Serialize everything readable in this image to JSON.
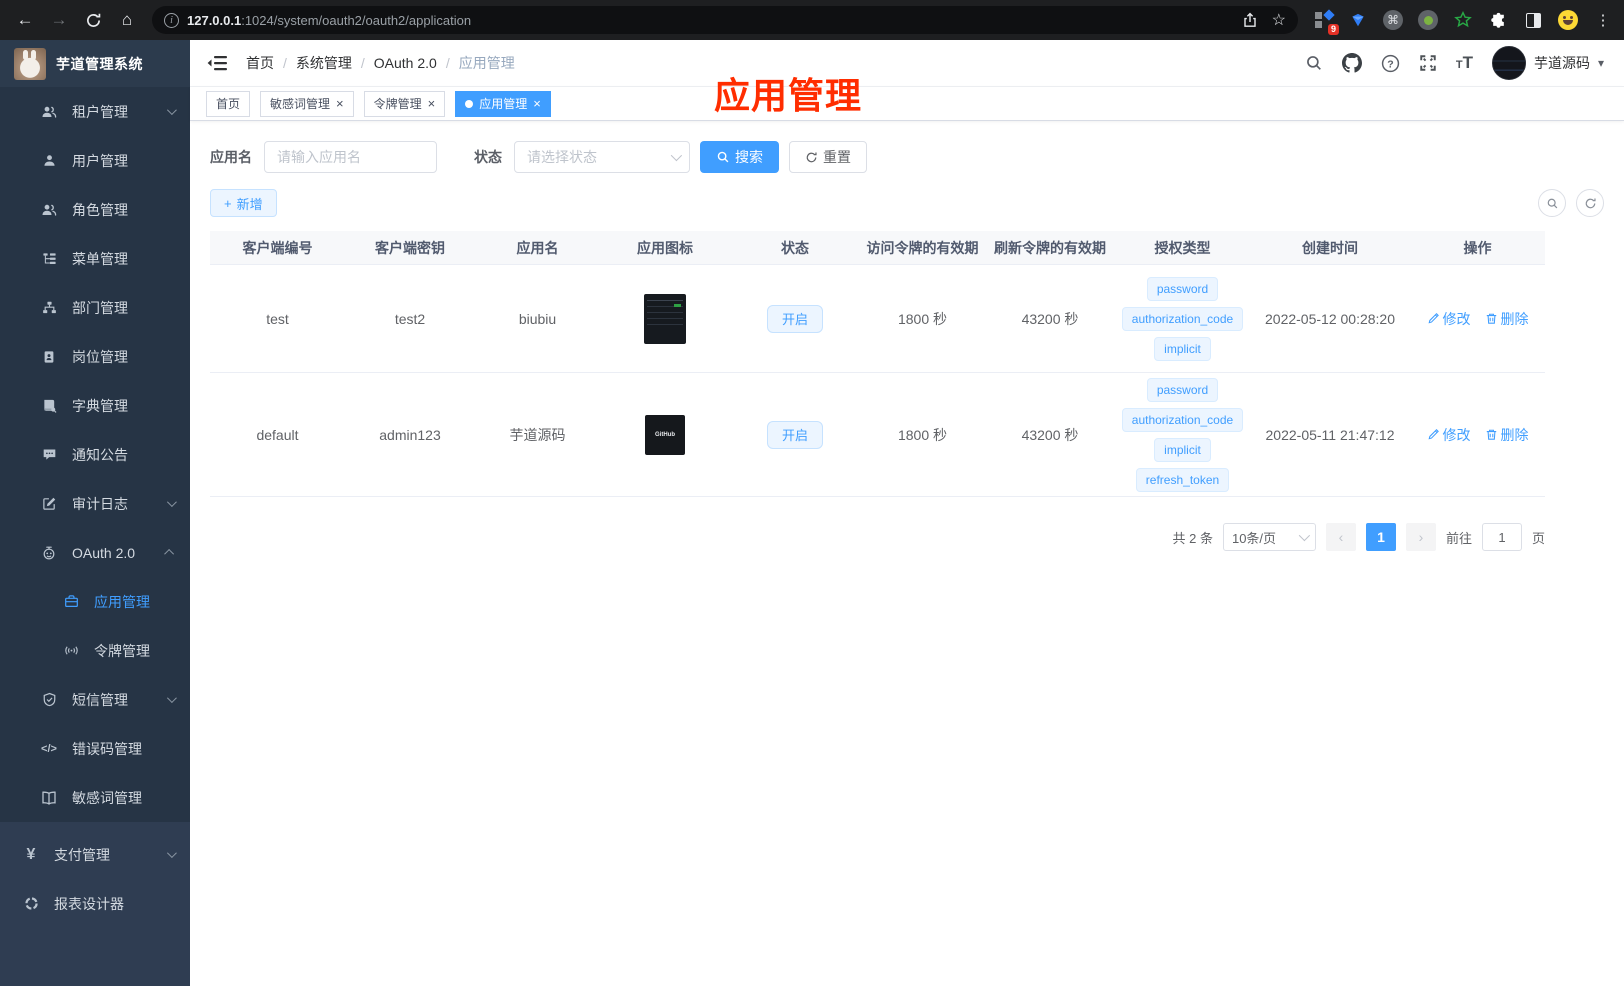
{
  "browser": {
    "url_host": "127.0.0.1",
    "url_rest": ":1024/system/oauth2/oauth2/application",
    "extensions_badge": "9"
  },
  "icons": {
    "back": "←",
    "forward": "→",
    "home": "⌂",
    "info": "i",
    "star": "☆",
    "command": "⌘",
    "kebab": "⋮",
    "question": "?",
    "caret_down": "▾",
    "breadcrumb_sep": "/",
    "close": "×",
    "plus": "+",
    "yen": "¥",
    "code": "</>",
    "font_t": "T",
    "prev": "‹",
    "next": "›"
  },
  "sidebar": {
    "title": "芋道管理系统",
    "items": [
      {
        "label": "租户管理"
      },
      {
        "label": "用户管理"
      },
      {
        "label": "角色管理"
      },
      {
        "label": "菜单管理"
      },
      {
        "label": "部门管理"
      },
      {
        "label": "岗位管理"
      },
      {
        "label": "字典管理"
      },
      {
        "label": "通知公告"
      },
      {
        "label": "审计日志"
      },
      {
        "label": "OAuth 2.0"
      },
      {
        "label": "应用管理"
      },
      {
        "label": "令牌管理"
      },
      {
        "label": "短信管理"
      },
      {
        "label": "错误码管理"
      },
      {
        "label": "敏感词管理"
      },
      {
        "label": "支付管理"
      },
      {
        "label": "报表设计器"
      }
    ]
  },
  "navbar": {
    "breadcrumb": [
      "首页",
      "系统管理",
      "OAuth 2.0",
      "应用管理"
    ],
    "user_name": "芋道源码"
  },
  "annotation": {
    "text": "应用管理",
    "color": "#ff2d00"
  },
  "tabs": [
    {
      "label": "首页"
    },
    {
      "label": "敏感词管理"
    },
    {
      "label": "令牌管理"
    },
    {
      "label": "应用管理"
    }
  ],
  "filters": {
    "name_label": "应用名",
    "name_placeholder": "请输入应用名",
    "status_label": "状态",
    "status_placeholder": "请选择状态",
    "search_label": "搜索",
    "reset_label": "重置",
    "add_label": "新增"
  },
  "table": {
    "columns": [
      "客户端编号",
      "客户端密钥",
      "应用名",
      "应用图标",
      "状态",
      "访问令牌的有效期",
      "刷新令牌的有效期",
      "授权类型",
      "创建时间",
      "操作"
    ],
    "edit_label": "修改",
    "delete_label": "删除",
    "rows": [
      {
        "client_id": "test",
        "client_secret": "test2",
        "app_name": "biubiu",
        "icon": "dark-dashboard-thumbnail",
        "status": "开启",
        "access_token_validity": "1800 秒",
        "refresh_token_validity": "43200 秒",
        "grants": [
          "password",
          "authorization_code",
          "implicit"
        ],
        "created_at": "2022-05-12 00:28:20"
      },
      {
        "client_id": "default",
        "client_secret": "admin123",
        "app_name": "芋道源码",
        "icon": "github-dark-logo",
        "icon_text": "GitHub",
        "status": "开启",
        "access_token_validity": "1800 秒",
        "refresh_token_validity": "43200 秒",
        "grants": [
          "password",
          "authorization_code",
          "implicit",
          "refresh_token"
        ],
        "created_at": "2022-05-11 21:47:12"
      }
    ]
  },
  "pagination": {
    "total": "共 2 条",
    "page_size": "10条/页",
    "current_page": "1",
    "goto_label": "前往",
    "goto_value": "1",
    "page_unit": "页"
  }
}
